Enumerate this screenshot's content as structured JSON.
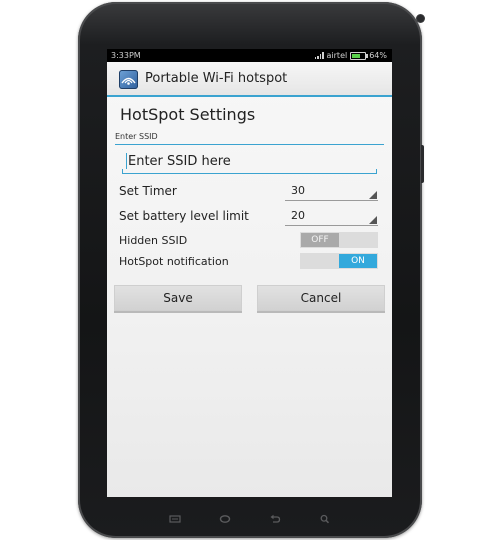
{
  "status_bar": {
    "time": "3:33PM",
    "carrier": "airtel",
    "battery_text": "64%",
    "battery_level": 0.64,
    "battery_color": "#5ad04b"
  },
  "app_bar": {
    "title": "Portable Wi-Fi hotspot",
    "icon": "hotspot-app-icon",
    "accent_color": "#3ba3d0"
  },
  "settings": {
    "heading": "HotSpot Settings",
    "ssid": {
      "label": "Enter SSID",
      "placeholder": "Enter SSID here",
      "value": ""
    },
    "timer": {
      "label": "Set Timer",
      "value": "30"
    },
    "battery_limit": {
      "label": "Set battery level limit",
      "value": "20"
    },
    "hidden_ssid": {
      "label": "Hidden SSID",
      "state": "OFF",
      "on": false
    },
    "notification": {
      "label": "HotSpot notification",
      "state": "ON",
      "on": true,
      "color": "#33a9dc"
    }
  },
  "buttons": {
    "save": "Save",
    "cancel": "Cancel"
  },
  "nav_keys": [
    "menu-icon",
    "home-icon",
    "back-icon",
    "search-icon"
  ]
}
